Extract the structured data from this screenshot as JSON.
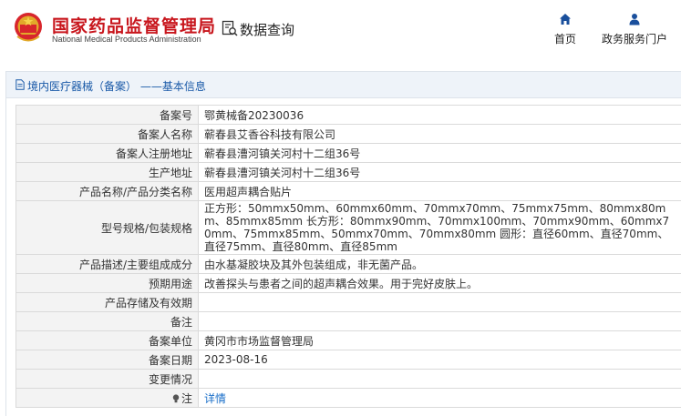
{
  "header": {
    "brand_cn": "国家药品监督管理局",
    "brand_en": "National Medical Products Administration",
    "query_label": "数据查询",
    "nav": {
      "home_label": "首页",
      "gov_label": "政务服务门户"
    }
  },
  "panel": {
    "title": "境内医疗器械（备案） ——基本信息"
  },
  "rows": [
    {
      "key": "备案号",
      "value": "鄂黄械备20230036"
    },
    {
      "key": "备案人名称",
      "value": "蕲春县艾香谷科技有限公司"
    },
    {
      "key": "备案人注册地址",
      "value": "蕲春县漕河镇关河村十二组36号"
    },
    {
      "key": "生产地址",
      "value": "蕲春县漕河镇关河村十二组36号"
    },
    {
      "key": "产品名称/产品分类名称",
      "value": "医用超声耦合贴片"
    },
    {
      "key": "型号规格/包装规格",
      "value": "正方形：50mmx50mm、60mmx60mm、70mmx70mm、75mmx75mm、80mmx80mm、85mmx85mm 长方形：80mmx90mm、70mmx100mm、70mmx90mm、60mmx70mm、75mmx85mm、50mmx70mm、70mmx80mm 圆形：直径60mm、直径70mm、直径75mm、直径80mm、直径85mm"
    },
    {
      "key": "产品描述/主要组成成分",
      "value": "由水基凝胶块及其外包装组成，非无菌产品。"
    },
    {
      "key": "预期用途",
      "value": "改善探头与患者之间的超声耦合效果。用于完好皮肤上。"
    },
    {
      "key": "产品存储及有效期",
      "value": ""
    },
    {
      "key": "备注",
      "value": ""
    },
    {
      "key": "备案单位",
      "value": "黄冈市市场监督管理局"
    },
    {
      "key": "备案日期",
      "value": "2023-08-16"
    },
    {
      "key": "变更情况",
      "value": ""
    },
    {
      "key": "注",
      "value": "详情"
    }
  ],
  "colors": {
    "brand_red": "#c8161d",
    "link_blue": "#1a6fc9",
    "nav_blue": "#1a4f9c"
  }
}
